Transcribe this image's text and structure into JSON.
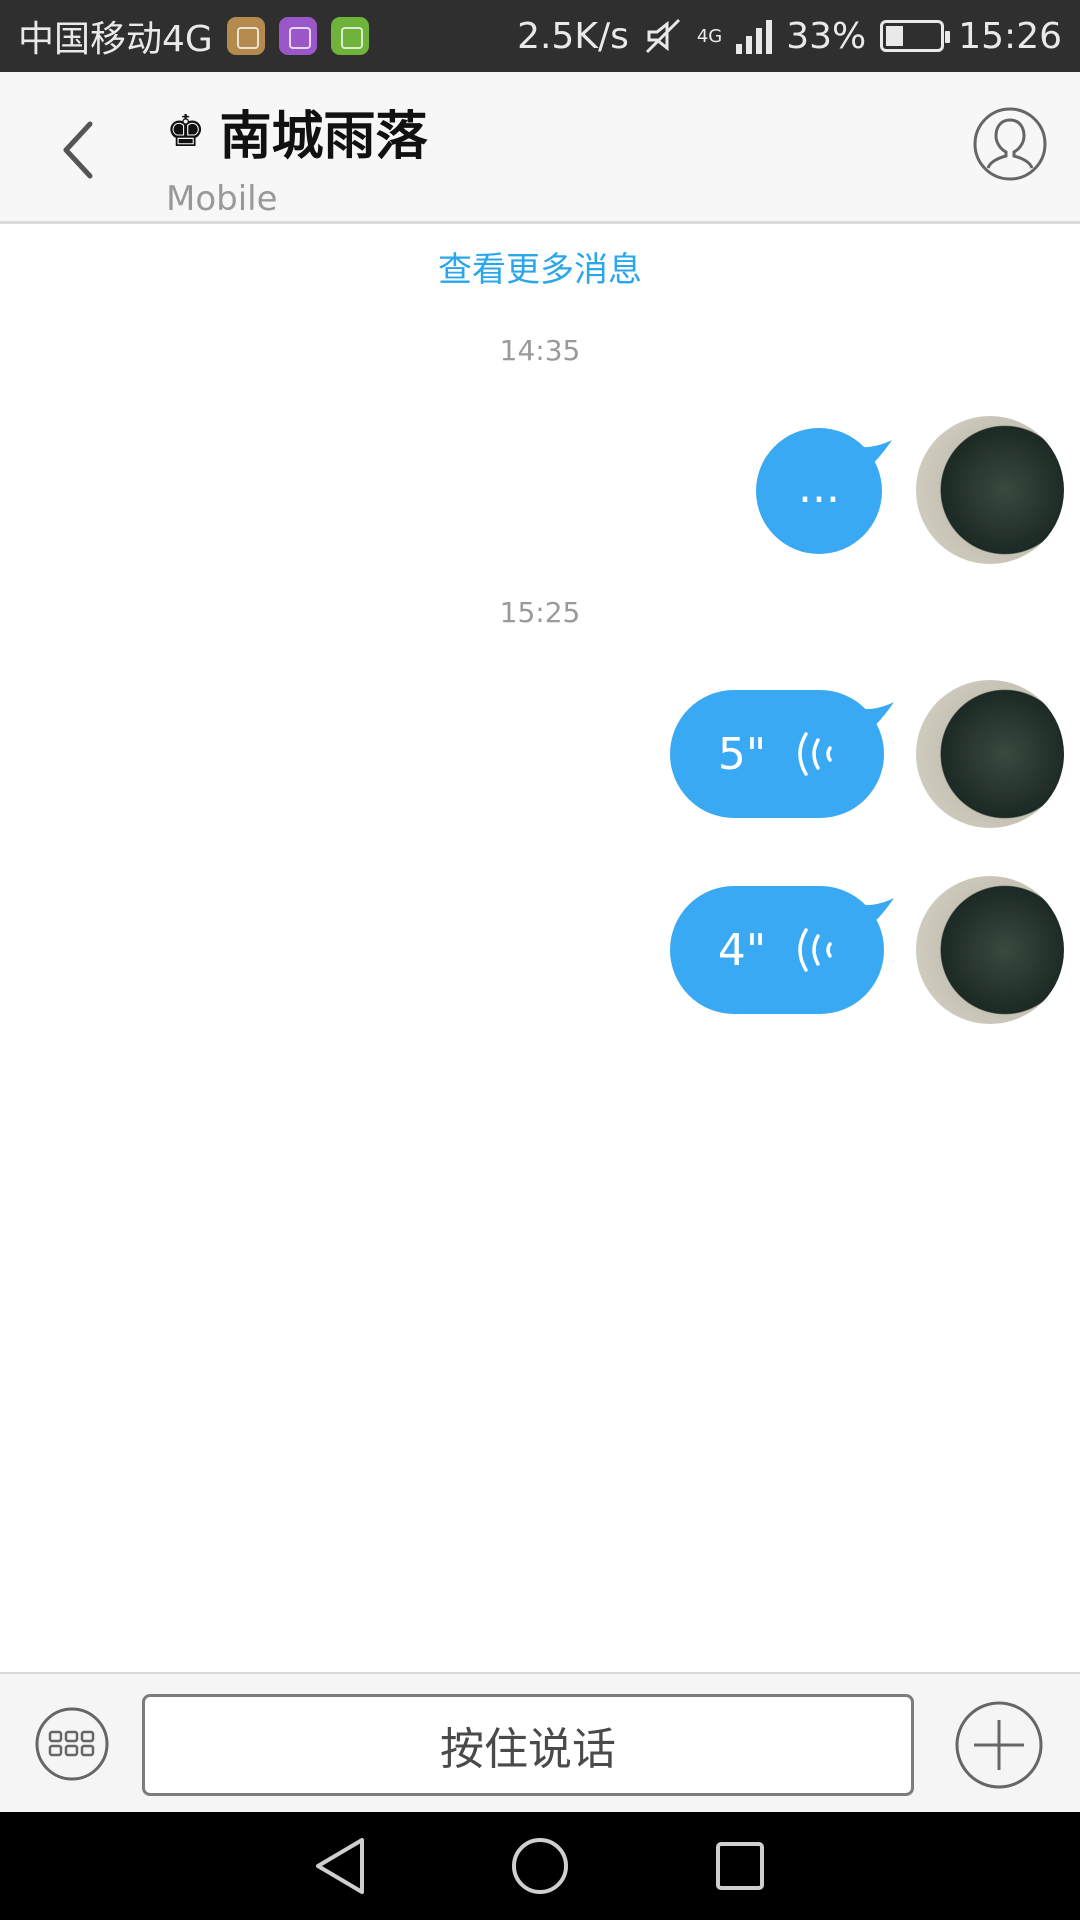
{
  "status_bar": {
    "carrier": "中国移动4G",
    "network_speed": "2.5K/s",
    "network_type": "4G",
    "battery_percent": "33%",
    "battery_level": 0.33,
    "time": "15:26",
    "icons": [
      "app-notification-icon",
      "gallery-notification-icon",
      "data-transfer-icon",
      "mute-icon",
      "signal-icon",
      "battery-icon"
    ]
  },
  "header": {
    "title": "南城雨落",
    "crown_glyph": "♚",
    "subtitle": "Mobile"
  },
  "chat": {
    "load_more": "查看更多消息",
    "groups": [
      {
        "time": "14:35",
        "messages": [
          {
            "type": "text",
            "text": "..."
          }
        ]
      },
      {
        "time": "15:25",
        "messages": [
          {
            "type": "voice",
            "duration": "5\""
          },
          {
            "type": "voice",
            "duration": "4\""
          }
        ]
      }
    ]
  },
  "input_bar": {
    "voice_label": "按住说话"
  },
  "colors": {
    "bubble": "#3aa9f4",
    "link": "#2aa6ec",
    "status_bar": "#2f2f2f",
    "nav_bar": "#000000"
  }
}
